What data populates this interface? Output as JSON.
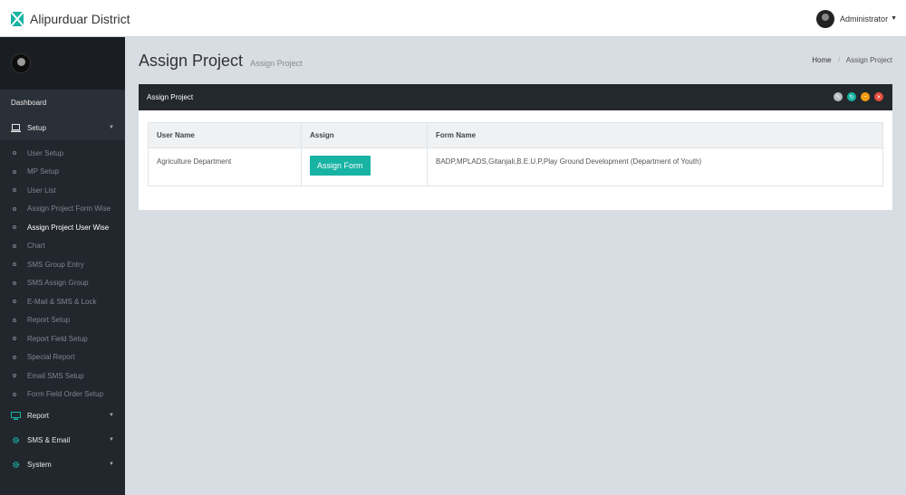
{
  "app": {
    "title": "Alipurduar District"
  },
  "user": {
    "name": "Administrator"
  },
  "sidebar": {
    "dashboard": "Dashboard",
    "setup": {
      "label": "Setup",
      "items": [
        "User Setup",
        "MP Setup",
        "User List",
        "Assign Project Form Wise",
        "Assign Project User Wise",
        "Chart",
        "SMS Group Entry",
        "SMS Assign Group",
        "E-Mail & SMS & Lock",
        "Report Setup",
        "Report Field Setup",
        "Special Report",
        "Email SMS Setup",
        "Form Field Order Setup"
      ],
      "active_item": "Assign Project User Wise"
    },
    "report": "Report",
    "sms_email": "SMS & Email",
    "system": "System"
  },
  "page": {
    "title": "Assign Project",
    "subtitle": "Assign Project",
    "breadcrumb": [
      "Home",
      "Assign Project"
    ]
  },
  "panel": {
    "title": "Assign Project",
    "tools": [
      {
        "icon": "wrench-icon",
        "color": "#b6bcc2"
      },
      {
        "icon": "refresh-icon",
        "color": "#17b3a3"
      },
      {
        "icon": "minimize-icon",
        "color": "#f39c12"
      },
      {
        "icon": "close-icon",
        "color": "#e74c3c"
      }
    ]
  },
  "table": {
    "headers": [
      "User Name",
      "Assign",
      "Form Name"
    ],
    "rows": [
      {
        "user_name": "Agriculture Department",
        "button": "Assign Form",
        "form_name": "BADP,MPLADS,Gitanjali,B.E.U.P,Play Ground Development (Department of Youth)"
      }
    ]
  }
}
